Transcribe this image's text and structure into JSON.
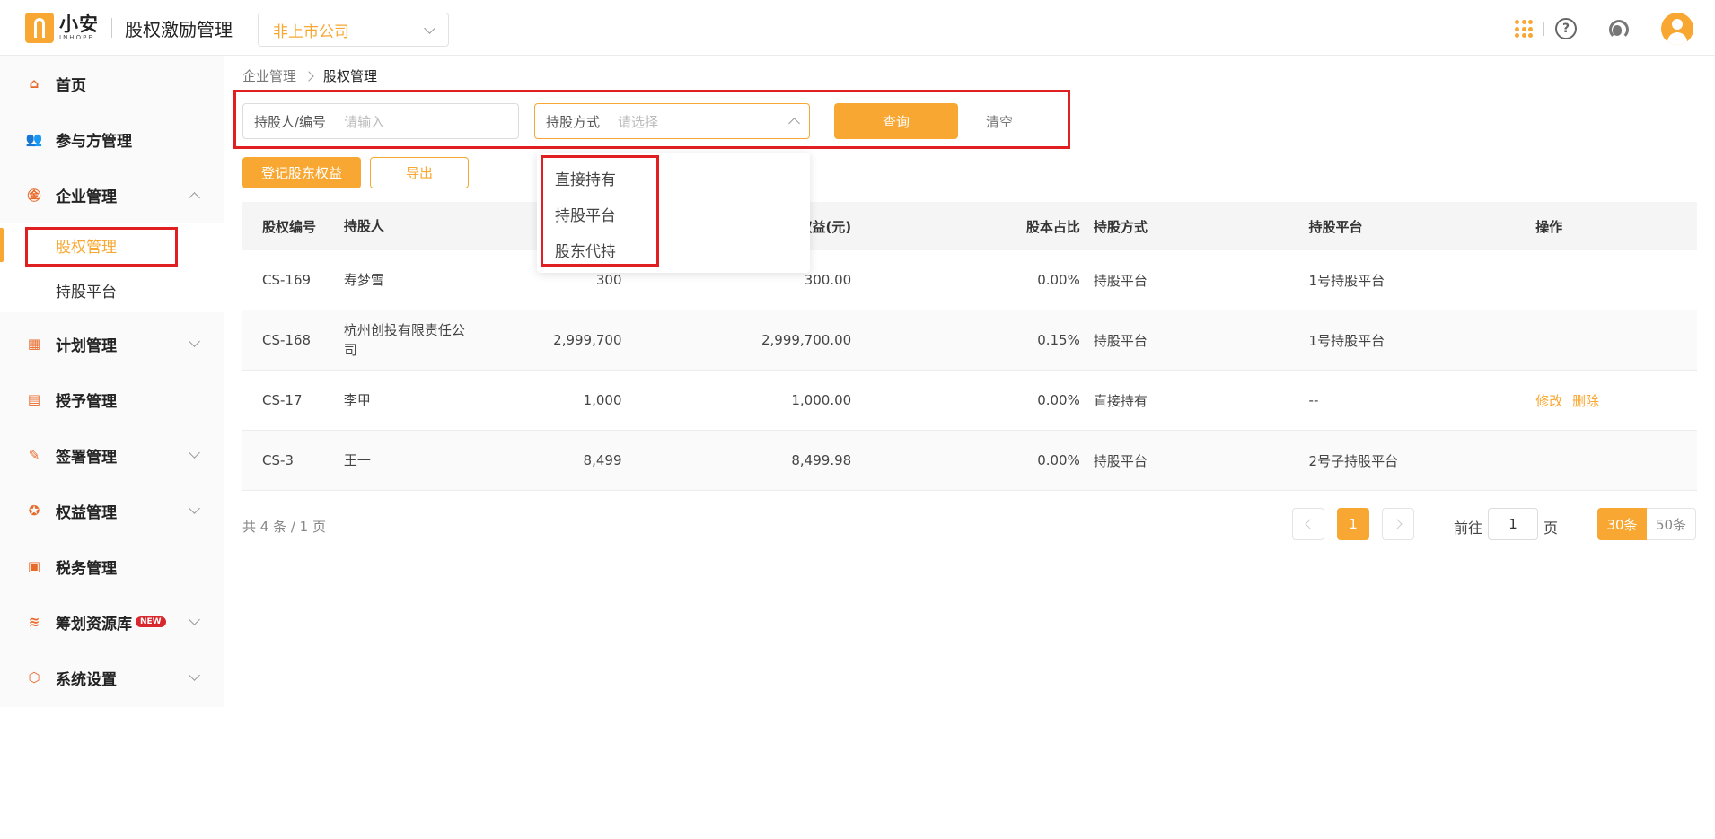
{
  "header": {
    "logo_cn": "小安",
    "logo_en": "INHOPE",
    "app_title": "股权激励管理",
    "company": "非上市公司"
  },
  "sidebar": {
    "items": [
      {
        "label": "首页"
      },
      {
        "label": "参与方管理"
      },
      {
        "label": "企业管理"
      },
      {
        "label": "计划管理"
      },
      {
        "label": "授予管理"
      },
      {
        "label": "签署管理"
      },
      {
        "label": "权益管理"
      },
      {
        "label": "税务管理"
      },
      {
        "label": "筹划资源库"
      },
      {
        "label": "系统设置"
      }
    ],
    "sub_items": [
      "股权管理",
      "持股平台"
    ],
    "new_badge": "NEW"
  },
  "breadcrumb": {
    "parent": "企业管理",
    "current": "股权管理"
  },
  "filter": {
    "holder_label": "持股人/编号",
    "holder_placeholder": "请输入",
    "method_label": "持股方式",
    "method_placeholder": "请选择",
    "query": "查询",
    "clear": "清空"
  },
  "dropdown": {
    "options": [
      "直接持有",
      "持股平台",
      "股东代持"
    ]
  },
  "actions": {
    "register": "登记股东权益",
    "export": "导出"
  },
  "table": {
    "headers": [
      "股权编号",
      "持股人",
      "",
      "权益(元)",
      "股本占比",
      "持股方式",
      "持股平台",
      "操作"
    ],
    "rows": [
      {
        "id": "CS-169",
        "holder": "寿梦雪",
        "shares": "300",
        "equity": "300.00",
        "ratio": "0.00%",
        "method": "持股平台",
        "platform": "1号持股平台",
        "ops": []
      },
      {
        "id": "CS-168",
        "holder": "杭州创投有限责任公司",
        "shares": "2,999,700",
        "equity": "2,999,700.00",
        "ratio": "0.15%",
        "method": "持股平台",
        "platform": "1号持股平台",
        "ops": []
      },
      {
        "id": "CS-17",
        "holder": "李甲",
        "shares": "1,000",
        "equity": "1,000.00",
        "ratio": "0.00%",
        "method": "直接持有",
        "platform": "--",
        "ops": [
          "修改",
          "删除"
        ]
      },
      {
        "id": "CS-3",
        "holder": "王一",
        "shares": "8,499",
        "equity": "8,499.98",
        "ratio": "0.00%",
        "method": "持股平台",
        "platform": "2号子持股平台",
        "ops": []
      }
    ]
  },
  "pagination": {
    "total": "共 4 条 / 1 页",
    "current": "1",
    "goto_prefix": "前往",
    "goto_value": "1",
    "goto_suffix": "页",
    "sizes": [
      "30条",
      "50条"
    ]
  },
  "colors": {
    "accent": "#f8a832",
    "highlight": "#e02020"
  }
}
